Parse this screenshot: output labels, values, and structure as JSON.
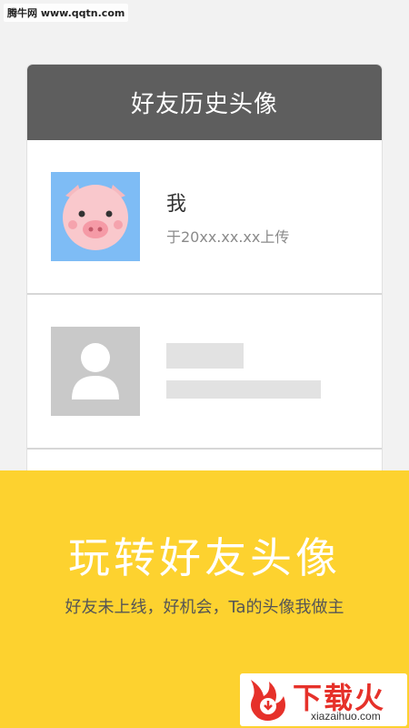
{
  "watermark": "腾牛网 www.qqtn.com",
  "card": {
    "title": "好友历史头像",
    "items": [
      {
        "name": "我",
        "subtitle": "于20xx.xx.xx上传",
        "avatar": "pig-avatar"
      },
      {
        "name": "",
        "subtitle": "",
        "avatar": "default-person-avatar"
      }
    ]
  },
  "banner": {
    "title": "玩转好友头像",
    "subtitle": "好友未上线，好机会，Ta的头像我做主"
  },
  "logo": {
    "text": "下载火",
    "url": "xiazaihuo.com"
  },
  "colors": {
    "header_bg": "#5e5e5e",
    "banner_bg": "#fdd22f",
    "pig_avatar_bg": "#7ebcf5",
    "logo_red": "#e6312a"
  }
}
